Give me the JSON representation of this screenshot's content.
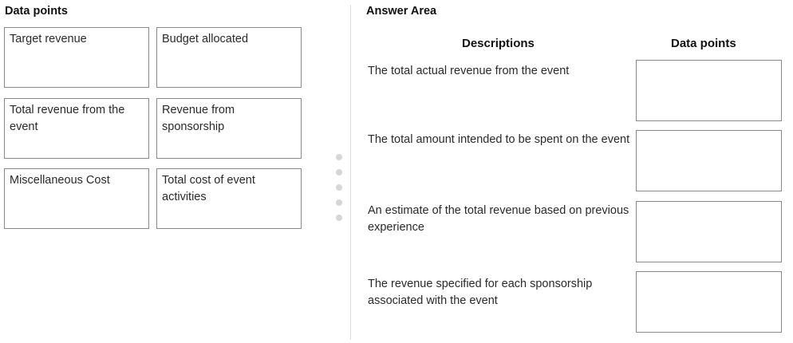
{
  "data_points_panel": {
    "title": "Data points",
    "items": [
      {
        "label": "Target revenue"
      },
      {
        "label": "Budget allocated"
      },
      {
        "label": "Total revenue from the event"
      },
      {
        "label": "Revenue from sponsorship"
      },
      {
        "label": "Miscellaneous Cost"
      },
      {
        "label": "Total cost of event activities"
      }
    ]
  },
  "answer_area": {
    "title": "Answer Area",
    "headers": {
      "descriptions": "Descriptions",
      "data_points": "Data points"
    },
    "rows": [
      {
        "description": "The total actual revenue from the event",
        "answer": ""
      },
      {
        "description": "The total amount intended to be spent on the event",
        "answer": ""
      },
      {
        "description": "An estimate of the total revenue based on previous experience",
        "answer": ""
      },
      {
        "description": "The revenue specified for each sponsorship associated with the event",
        "answer": ""
      }
    ]
  }
}
